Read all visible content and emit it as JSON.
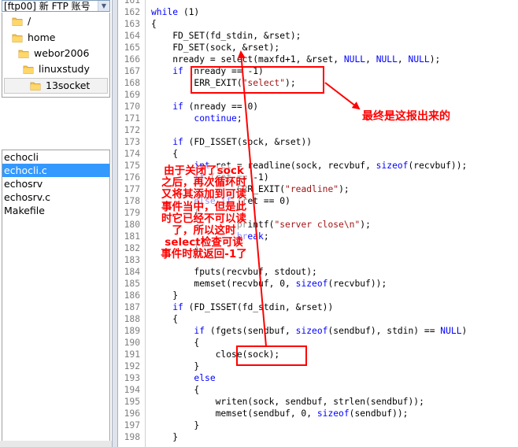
{
  "left_panel": {
    "account_combo": "[ftp00] 新 FTP 账号",
    "tree": [
      {
        "label": "/"
      },
      {
        "label": "home"
      },
      {
        "label": "webor2006"
      },
      {
        "label": "linuxstudy"
      },
      {
        "label": "13socket"
      }
    ],
    "files": [
      "echocli",
      "echocli.c",
      "echosrv",
      "echosrv.c",
      "Makefile"
    ],
    "selected_file": "echocli.c"
  },
  "editor": {
    "lines": [
      {
        "n": "161",
        "t": ""
      },
      {
        "n": "162",
        "t": "        while (1)"
      },
      {
        "n": "163",
        "t": "        {"
      },
      {
        "n": "164",
        "t": "            FD_SET(fd_stdin, &rset);"
      },
      {
        "n": "165",
        "t": "            FD_SET(sock, &rset);"
      },
      {
        "n": "166",
        "t": "            nready = select(maxfd+1, &rset, NULL, NULL, NULL);"
      },
      {
        "n": "167",
        "t": "            if (nready == -1)"
      },
      {
        "n": "168",
        "t": "                ERR_EXIT(\"select\");"
      },
      {
        "n": "169",
        "t": ""
      },
      {
        "n": "170",
        "t": "            if (nready == 0)"
      },
      {
        "n": "171",
        "t": "                continue;"
      },
      {
        "n": "172",
        "t": ""
      },
      {
        "n": "173",
        "t": "            if (FD_ISSET(sock, &rset))"
      },
      {
        "n": "174",
        "t": "            {"
      },
      {
        "n": "175",
        "t": "                int ret = readline(sock, recvbuf, sizeof(recvbuf));"
      },
      {
        "n": "176",
        "t": "                if (ret == -1)"
      },
      {
        "n": "177",
        "t": "                        ERR_EXIT(\"readline\");"
      },
      {
        "n": "178",
        "t": "                else if (ret == 0)"
      },
      {
        "n": "179",
        "t": "                {"
      },
      {
        "n": "180",
        "t": "                        printf(\"server close\\n\");"
      },
      {
        "n": "181",
        "t": "                        break;"
      },
      {
        "n": "182",
        "t": "                }"
      },
      {
        "n": "183",
        "t": ""
      },
      {
        "n": "184",
        "t": "                fputs(recvbuf, stdout);"
      },
      {
        "n": "185",
        "t": "                memset(recvbuf, 0, sizeof(recvbuf));"
      },
      {
        "n": "186",
        "t": "            }"
      },
      {
        "n": "187",
        "t": "            if (FD_ISSET(fd_stdin, &rset))"
      },
      {
        "n": "188",
        "t": "            {"
      },
      {
        "n": "189",
        "t": "                if (fgets(sendbuf, sizeof(sendbuf), stdin) == NULL)"
      },
      {
        "n": "190",
        "t": "                {"
      },
      {
        "n": "191",
        "t": "                    close(sock);"
      },
      {
        "n": "192",
        "t": "                }"
      },
      {
        "n": "193",
        "t": "                else"
      },
      {
        "n": "194",
        "t": "                {"
      },
      {
        "n": "195",
        "t": "                    writen(sock, sendbuf, strlen(sendbuf));"
      },
      {
        "n": "196",
        "t": "                    memset(sendbuf, 0, sizeof(sendbuf));"
      },
      {
        "n": "197",
        "t": "                }"
      },
      {
        "n": "198",
        "t": "            }"
      }
    ],
    "keywords": [
      "while",
      "if",
      "else",
      "continue",
      "break",
      "sizeof",
      "int",
      "NULL"
    ]
  },
  "annotations": {
    "note_result": "最终是这报出来的",
    "note_explain": "由于关闭了sock之后，再次循环时又将其添加到可读事件当中，但是此时它已经不可以读了，所以这时select检查可读事件时就返回-1了"
  },
  "colors": {
    "annotation": "#ff0000",
    "keyword": "#0000ff",
    "string": "#a31515",
    "selection": "#3399ff"
  }
}
